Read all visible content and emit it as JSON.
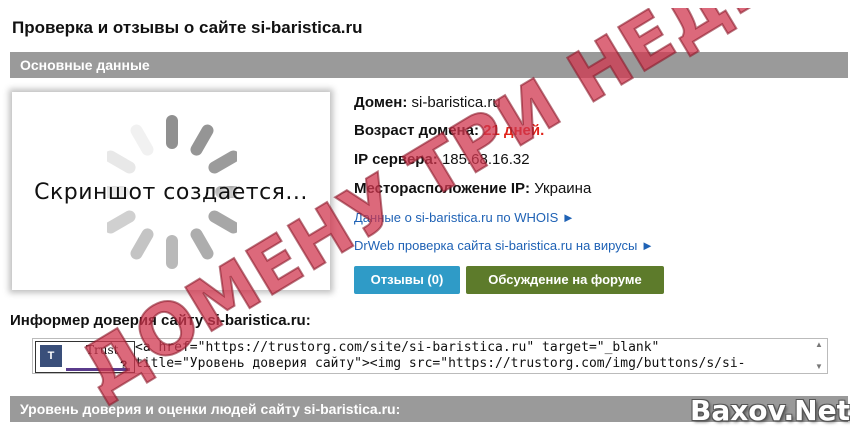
{
  "page": {
    "title": "Проверка и отзывы о сайте si-baristica.ru"
  },
  "sections": {
    "basic": "Основные данные",
    "trust": "Уровень доверия и оценки людей сайту si-baristica.ru:"
  },
  "screenshot": {
    "caption": "Скриншот создается..."
  },
  "info": {
    "domain_label": "Домен:",
    "domain_value": "si-baristica.ru",
    "age_label": "Возраст домена:",
    "age_value": "21 дней.",
    "ip_label": "IP сервера:",
    "ip_value": "185.68.16.32",
    "location_label": "Месторасположение IP:",
    "location_value": "Украина"
  },
  "links": {
    "whois": "Данные о si-baristica.ru по WHOIS ►",
    "drweb": "DrWeb проверка сайта si-baristica.ru на вирусы ►"
  },
  "buttons": {
    "reviews": "Отзывы (0)",
    "forum": "Обсуждение на форуме"
  },
  "informer": {
    "label": "Информер доверия сайту si-baristica.ru:",
    "code_line1": "<a href=\"https://trustorg.com/site/si-baristica.ru\" target=\"_blank\"",
    "code_line2": "title=\"Уровень доверия сайту\"><img src=\"https://trustorg.com/img/buttons/s/si-",
    "badge_word": "Trust",
    "badge_q": "?"
  },
  "watermarks": {
    "stamp": "ДОМЕНУ ТРИ НЕДЕЛИ",
    "corner": "Baxov.Net"
  },
  "colors": {
    "section_bar": "#9a9a9a",
    "age_red": "#e0241b",
    "link_blue": "#1f62b5",
    "btn_reviews": "#2f9bc7",
    "btn_forum": "#5d7b2b",
    "stamp": "#d0374f"
  }
}
